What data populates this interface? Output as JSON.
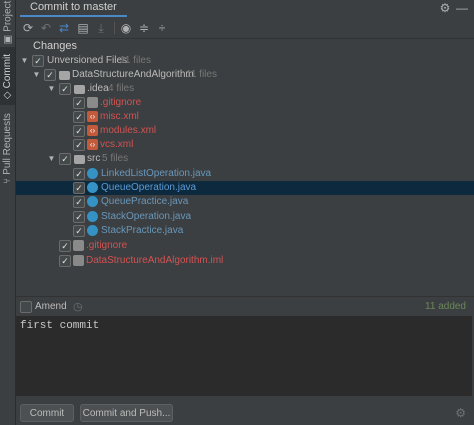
{
  "sidebar": {
    "tabs": [
      {
        "label": "Project"
      },
      {
        "label": "Commit"
      },
      {
        "label": "Pull Requests"
      }
    ]
  },
  "header": {
    "tab_label": "Commit to master"
  },
  "changes": {
    "label": "Changes",
    "unversioned": {
      "label": "Unversioned Files",
      "count": "11 files"
    },
    "project": {
      "label": "DataStructureAndAlgorithm",
      "count": "11 files"
    },
    "idea": {
      "label": ".idea",
      "count": "4 files"
    },
    "idea_files": [
      ".gitignore",
      "misc.xml",
      "modules.xml",
      "vcs.xml"
    ],
    "src": {
      "label": "src",
      "count": "5 files"
    },
    "src_files": [
      "LinkedListOperation.java",
      "QueueOperation.java",
      "QueuePractice.java",
      "StackOperation.java",
      "StackPractice.java"
    ],
    "root_files": [
      ".gitignore",
      "DataStructureAndAlgorithm.iml"
    ]
  },
  "commit": {
    "amend_label": "Amend",
    "added_status": "11 added",
    "message": "first commit",
    "commit_label": "Commit",
    "commit_push_label": "Commit and Push..."
  },
  "colors": {
    "accent": "#4a88c7",
    "unversioned_file": "#d25252",
    "java_file": "#6897bb",
    "added": "#6a8759",
    "selection": "#0d293e"
  },
  "icons": {
    "toolbar": [
      "refresh-icon",
      "rollback-icon",
      "diff-icon",
      "shelve-icon",
      "download-icon",
      "eye-icon",
      "expand-all-icon",
      "collapse-all-icon"
    ]
  }
}
